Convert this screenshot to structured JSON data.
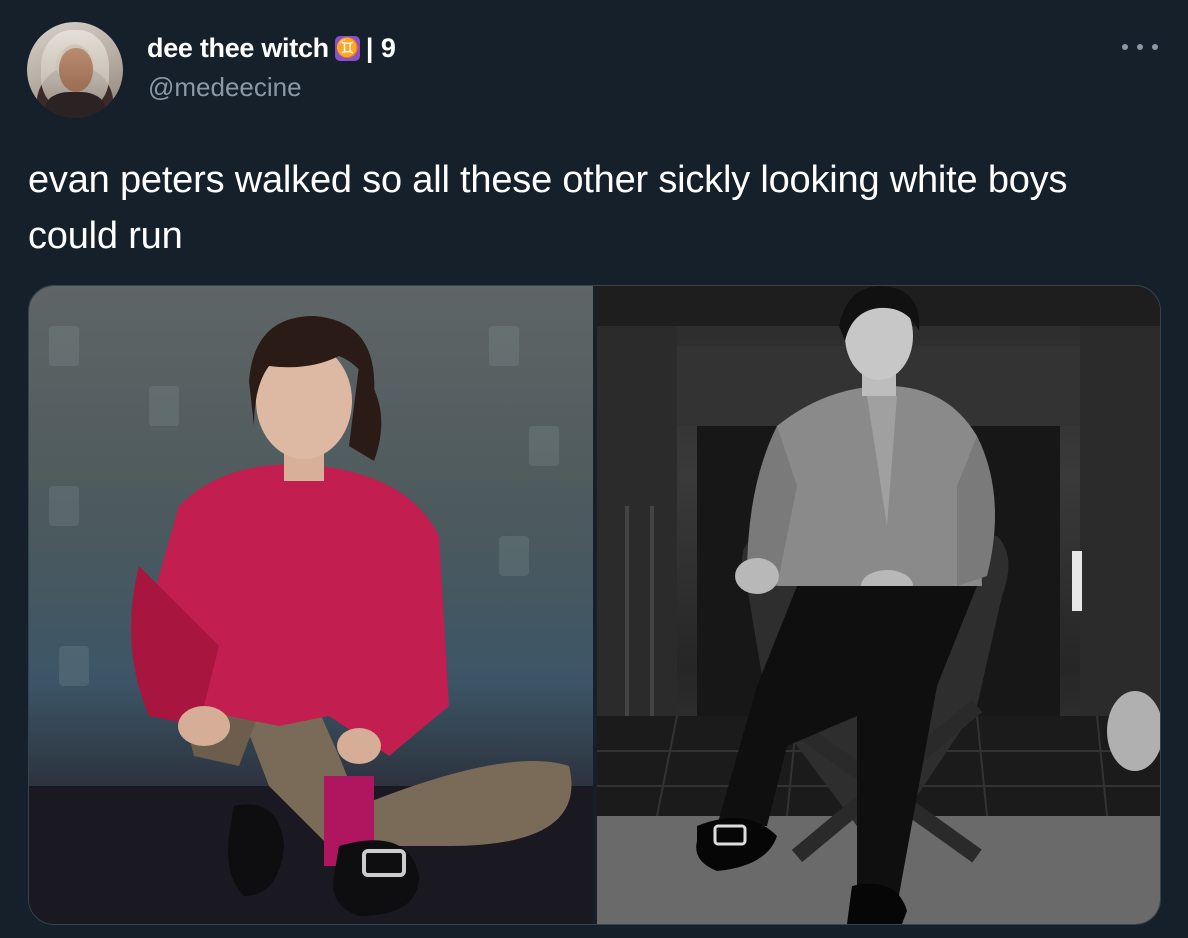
{
  "tweet": {
    "display_name": "dee thee witch",
    "badge_glyph": "♊",
    "name_suffix": "| 9",
    "handle": "@medeecine",
    "text": "evan peters walked so all these other sickly looking white boys could run"
  },
  "media": {
    "image_count": 2
  },
  "icons": {
    "more": "more-horizontal-icon",
    "badge": "gemini-icon"
  },
  "colors": {
    "background": "#15202b",
    "text_primary": "#ffffff",
    "text_secondary": "#8b98a5",
    "badge": "#8a4fc9",
    "border": "#38444d"
  }
}
